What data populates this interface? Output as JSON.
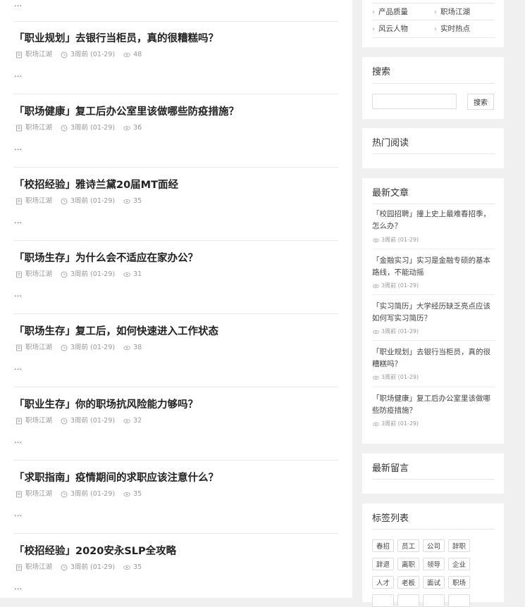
{
  "main": {
    "top_ellipsis": "…",
    "articles": [
      {
        "title": "「职业规划」去银行当柜员，真的很糟糕吗？",
        "category": "职场江湖",
        "time": "3周前 (01-29)",
        "views": "48",
        "excerpt": "…"
      },
      {
        "title": "「职场健康」复工后办公室里该做哪些防疫措施？",
        "category": "职场江湖",
        "time": "3周前 (01-29)",
        "views": "36",
        "excerpt": "…"
      },
      {
        "title": "「校招经验」雅诗兰黛20届MT面经",
        "category": "职场江湖",
        "time": "3周前 (01-29)",
        "views": "35",
        "excerpt": "…"
      },
      {
        "title": "「职场生存」为什么会不适应在家办公？",
        "category": "职场江湖",
        "time": "3周前 (01-29)",
        "views": "31",
        "excerpt": "…"
      },
      {
        "title": "「职场生存」复工后，如何快速进入工作状态",
        "category": "职场江湖",
        "time": "3周前 (01-29)",
        "views": "38",
        "excerpt": "…"
      },
      {
        "title": "「职业生存」你的职场抗风险能力够吗？",
        "category": "职场江湖",
        "time": "3周前 (01-29)",
        "views": "32",
        "excerpt": "…"
      },
      {
        "title": "「求职指南」疫情期间的求职应该注意什么？",
        "category": "职场江湖",
        "time": "3周前 (01-29)",
        "views": "35",
        "excerpt": "…"
      },
      {
        "title": "「校招经验」2020安永SLP全攻略",
        "category": "职场江湖",
        "time": "3周前 (01-29)",
        "views": "35",
        "excerpt": "…"
      }
    ]
  },
  "sidebar": {
    "categories": {
      "items": [
        "产品质量",
        "职场江湖",
        "风云人物",
        "实时热点"
      ]
    },
    "search": {
      "title": "搜索",
      "placeholder": "",
      "button": "搜索"
    },
    "hot": {
      "title": "热门阅读"
    },
    "latest": {
      "title": "最新文章",
      "posts": [
        {
          "title": "「校园招聘」撞上史上最难春招季，怎么办？",
          "time": "3周前 (01-29)"
        },
        {
          "title": "「金融实习」实习是金融专硕的基本路线，不能动摇",
          "time": "3周前 (01-29)"
        },
        {
          "title": "「实习简历」大学经历缺乏亮点应该如何写实习简历？",
          "time": "3周前 (01-29)"
        },
        {
          "title": "「职业规划」去银行当柜员，真的很糟糕吗？",
          "time": "3周前 (01-29)"
        },
        {
          "title": "「职场健康」复工后办公室里该做哪些防疫措施？",
          "time": "3周前 (01-29)"
        }
      ]
    },
    "comments": {
      "title": "最新留言"
    },
    "tags": {
      "title": "标签列表",
      "items": [
        "春招",
        "员工",
        "公司",
        "辞职",
        "辞退",
        "离职",
        "领导",
        "企业",
        "人才",
        "老板",
        "面试",
        "职场"
      ]
    }
  },
  "colors": {
    "background": "#f0f0f0",
    "panel": "#ffffff",
    "title_text": "#222222",
    "meta_text": "#999999"
  },
  "icons": {
    "category": "document-icon",
    "time": "clock-icon",
    "views": "eye-icon",
    "list_bullet": "chevron-right-icon"
  }
}
